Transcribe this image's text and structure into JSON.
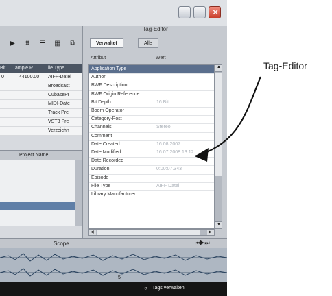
{
  "tag_editor": {
    "title": "Tag-Editor",
    "tabs": [
      {
        "label": "Verwaltet",
        "active": true
      },
      {
        "label": "Alle",
        "active": false
      }
    ],
    "columns": {
      "attribute": "Attribut",
      "value": "Wert"
    },
    "rows": [
      {
        "key": "Application Type",
        "value": "",
        "selected": true
      },
      {
        "key": "Author",
        "value": ""
      },
      {
        "key": "BWF Description",
        "value": ""
      },
      {
        "key": "BWF Origin Reference",
        "value": ""
      },
      {
        "key": "Bit Depth",
        "value": "16 Bit"
      },
      {
        "key": "Boom Operator",
        "value": ""
      },
      {
        "key": "Category-Post",
        "value": ""
      },
      {
        "key": "Channels",
        "value": "Stereo"
      },
      {
        "key": "Comment",
        "value": ""
      },
      {
        "key": "Date Created",
        "value": "16.08.2007"
      },
      {
        "key": "Date Modified",
        "value": "16.07.2008 13:12"
      },
      {
        "key": "Date Recorded",
        "value": ""
      },
      {
        "key": "Duration",
        "value": "0:00:07.343"
      },
      {
        "key": "Episode",
        "value": ""
      },
      {
        "key": "File Type",
        "value": "AIFF Datei"
      },
      {
        "key": "Library Manufacturer",
        "value": ""
      }
    ]
  },
  "left_panel": {
    "headers": [
      "Bit",
      "ample R",
      "ile Type"
    ],
    "rows": [
      {
        "c1": "0",
        "c2": "44100.00",
        "c3": "AIFF-Datei"
      },
      {
        "c1": "",
        "c2": "",
        "c3": "Broadcast"
      },
      {
        "c1": "",
        "c2": "",
        "c3": "CubasePr"
      },
      {
        "c1": "",
        "c2": "",
        "c3": "MIDI-Date"
      },
      {
        "c1": "",
        "c2": "",
        "c3": "Track Pre"
      },
      {
        "c1": "",
        "c2": "",
        "c3": "VST3 Pre"
      },
      {
        "c1": "",
        "c2": "",
        "c3": "Verzeichn"
      }
    ],
    "list_header": {
      "col_a": "",
      "col_b": "Project Name"
    }
  },
  "bottom": {
    "scope_label": "Scope",
    "status_label": "Tags verwalten",
    "marker": "5"
  },
  "annotation": {
    "label": "Tag-Editor"
  }
}
